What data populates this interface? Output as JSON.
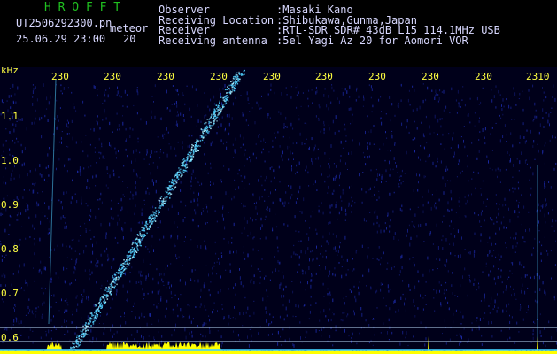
{
  "header": {
    "title": "H R O F F T",
    "filename": "UT2506292300.pn",
    "event_type": "meteor",
    "datetime": "25.06.29 23:00",
    "count": "20"
  },
  "meta": {
    "rows": [
      {
        "label": "Observer",
        "value": ":Masaki Kano"
      },
      {
        "label": "Receiving Location",
        "value": ":Shibukawa,Gunma,Japan"
      },
      {
        "label": "Receiver",
        "value": ":RTL-SDR SDR# 43dB L15 114.1MHz USB"
      },
      {
        "label": "Receiving antenna",
        "value": ":5el Yagi Az 20 for Aomori VOR"
      }
    ]
  },
  "spectrogram": {
    "unit_label": "kHz",
    "y_ticks": [
      "1.1",
      "1.0",
      "0.9",
      "0.8",
      "0.7",
      "0.6"
    ],
    "x_ticks": [
      "230",
      "230",
      "230",
      "230",
      "230",
      "230",
      "230",
      "230",
      "230",
      "2310"
    ],
    "colors": {
      "background": "#00001a",
      "noise": "#1c2aa8",
      "signal": "#50d0ff",
      "axis_text": "#ffff40",
      "trace": "#ffff00",
      "lines": "#c0e0ff"
    }
  }
}
